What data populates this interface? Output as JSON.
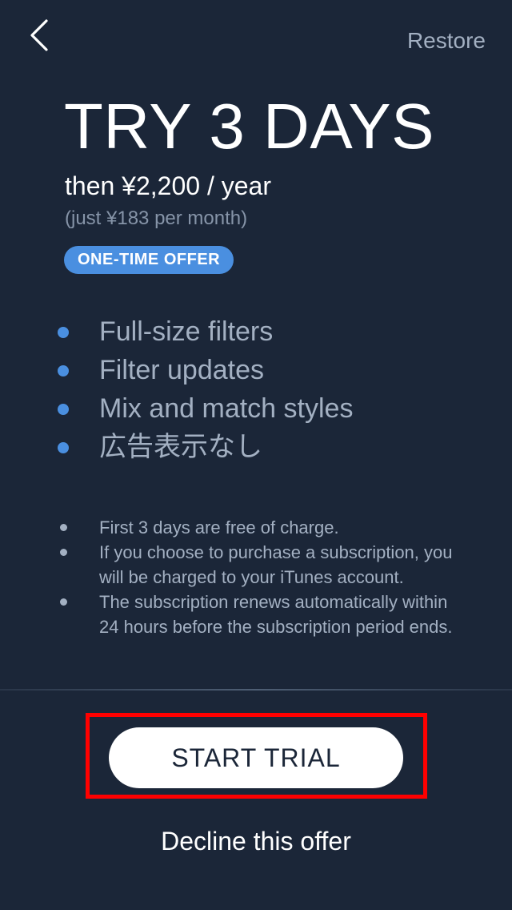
{
  "header": {
    "back_icon": "chevron-left-icon",
    "restore_label": "Restore"
  },
  "offer": {
    "headline": "TRY 3 DAYS",
    "price": "then ¥2,200 / year",
    "monthly": "(just ¥183 per month)",
    "badge": "ONE-TIME OFFER"
  },
  "features": [
    {
      "label": "Full-size filters"
    },
    {
      "label": "Filter updates"
    },
    {
      "label": "Mix and match styles"
    },
    {
      "label": "広告表示なし"
    }
  ],
  "terms": [
    {
      "text": "First 3 days are free of charge."
    },
    {
      "text": "If you choose to purchase a subscription, you will be charged to your iTunes account."
    },
    {
      "text": "The subscription renews automatically within 24 hours before the subscription period ends."
    }
  ],
  "actions": {
    "start_label": "START TRIAL",
    "decline_label": "Decline this offer"
  },
  "colors": {
    "background": "#1b2638",
    "accent": "#4a8fe0",
    "muted_text": "#a3b0c2",
    "highlight": "#ff0000"
  }
}
